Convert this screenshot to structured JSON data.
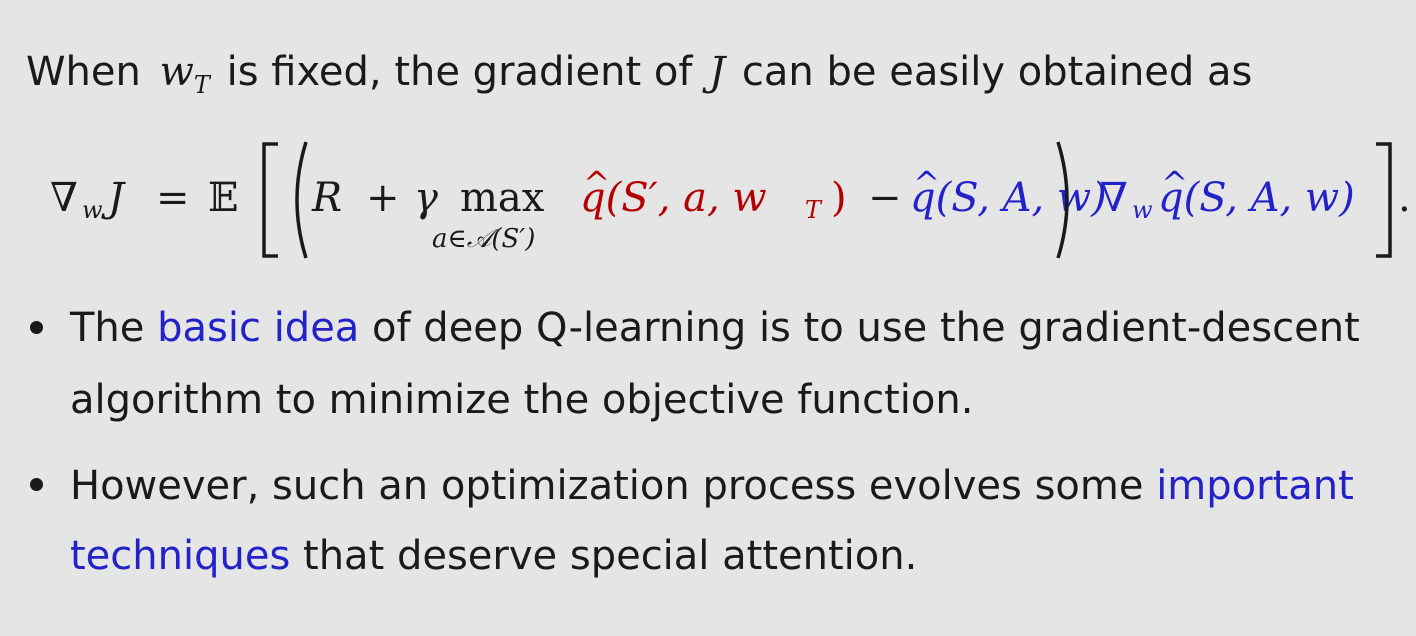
{
  "intro": {
    "before": "When",
    "var_main": "w",
    "var_sub": "T",
    "middle": "is fixed, the gradient of",
    "J": "J",
    "after": "can be easily obtained as"
  },
  "equation": {
    "lhs_nabla": "∇",
    "lhs_sub": "w",
    "lhs_J": "J",
    "eq": "=",
    "expect": "𝔼",
    "R": "R",
    "plus": "+",
    "gamma": "γ",
    "max": "max",
    "max_sub": "a∈𝒜(S′)",
    "target_q": "q(S′, a, w",
    "target_sub": "T",
    "target_close": ")",
    "minus": "−",
    "pred_q": "q(S, A, w)",
    "grad_nabla": "∇",
    "grad_sub": "w",
    "grad_q": "q(S, A, w)",
    "period": "."
  },
  "bullets": [
    {
      "line1_pre": "The",
      "line1_link": "basic idea",
      "line1_post": "of deep Q-learning is to use the gradient-descent",
      "line2": "algorithm to minimize the objective function."
    },
    {
      "line1_pre": "However, such an optimization process evolves some",
      "line1_link": "important",
      "line2_link": "techniques",
      "line2_post": "that deserve special attention."
    }
  ],
  "colors": {
    "background": "#e5e5e5",
    "text": "#1a1a1a",
    "highlight_blue": "#2222c8",
    "target_red": "#b40000"
  }
}
